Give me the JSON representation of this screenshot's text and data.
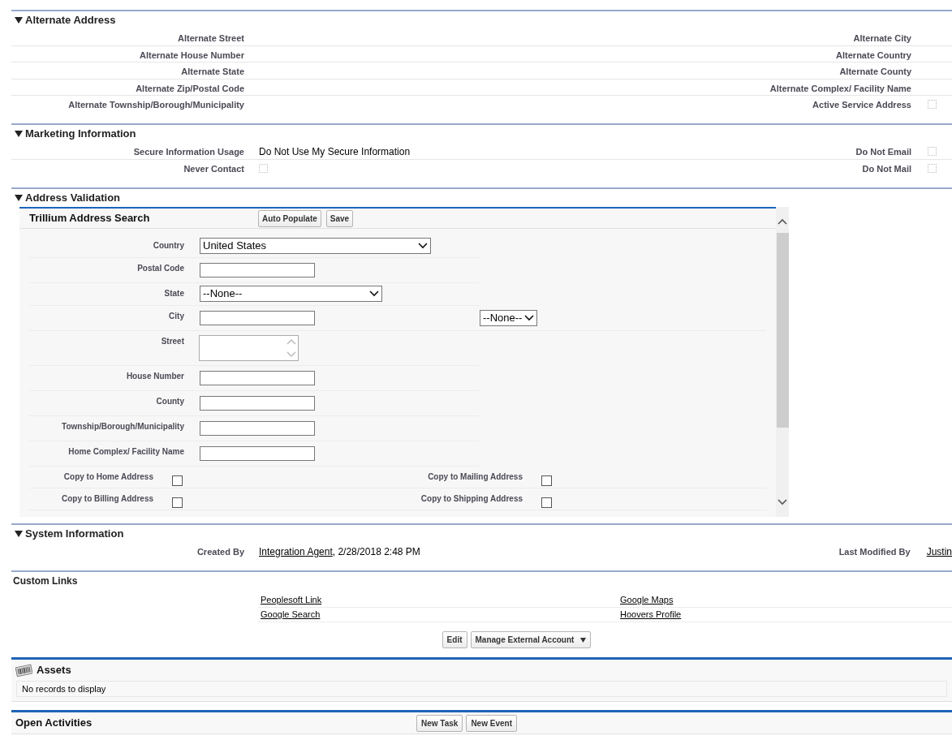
{
  "sections": [
    {
      "kind": "detail",
      "title": "Alternate Address",
      "expanded": true,
      "rows": [
        {
          "left": {
            "kind": "text",
            "label": "Alternate Street"
          },
          "right": {
            "kind": "text",
            "label": "Alternate City"
          }
        },
        {
          "left": {
            "kind": "text",
            "label": "Alternate House Number"
          },
          "right": {
            "kind": "text",
            "label": "Alternate Country"
          }
        },
        {
          "left": {
            "kind": "text",
            "label": "Alternate State"
          },
          "right": {
            "kind": "text",
            "label": "Alternate County"
          }
        },
        {
          "left": {
            "kind": "text",
            "label": "Alternate Zip/Postal Code"
          },
          "right": {
            "kind": "text",
            "label": "Alternate Complex/ Facility Name"
          }
        },
        {
          "left": {
            "kind": "text",
            "label": "Alternate Township/Borough/Municipality"
          },
          "right": {
            "kind": "checkbox",
            "label": "Active Service Address",
            "checked": false
          }
        }
      ]
    },
    {
      "kind": "detail",
      "title": "Marketing Information",
      "expanded": true,
      "rows": [
        {
          "left": {
            "kind": "text",
            "label": "Secure Information Usage",
            "value": "Do Not Use My Secure Information"
          },
          "right": {
            "kind": "checkbox",
            "label": "Do Not Email",
            "checked": false
          }
        },
        {
          "left": {
            "kind": "checkbox",
            "label": "Never Contact",
            "checked": false
          },
          "right": {
            "kind": "checkbox",
            "label": "Do Not Mail",
            "checked": false
          }
        }
      ]
    },
    {
      "kind": "embedded",
      "title": "Address Validation",
      "expanded": true,
      "panel": {
        "title": "Trillium Address Search",
        "buttons": [
          "Auto Populate",
          "Save"
        ],
        "fields": [
          {
            "kind": "select",
            "label": "Country",
            "value": "United States"
          },
          {
            "kind": "input",
            "label": "Postal Code"
          },
          {
            "kind": "select",
            "label": "State",
            "value": "--None--"
          },
          {
            "kind": "input",
            "label": "City",
            "extra_select": "--None--"
          },
          {
            "kind": "textarea",
            "label": "Street"
          },
          {
            "kind": "input",
            "label": "House Number"
          },
          {
            "kind": "input",
            "label": "County"
          },
          {
            "kind": "input",
            "label": "Township/Borough/Municipality"
          },
          {
            "kind": "input",
            "label": "Home Complex/ Facility Name"
          },
          {
            "kind": "checks",
            "items": [
              {
                "label": "Copy to Home Address",
                "checked": false
              },
              {
                "label": "Copy to Mailing Address",
                "checked": false
              }
            ]
          },
          {
            "kind": "checks",
            "items": [
              {
                "label": "Copy to Billing Address",
                "checked": false
              },
              {
                "label": "Copy to Shipping Address",
                "checked": false
              }
            ]
          }
        ]
      }
    },
    {
      "kind": "detail",
      "title": "System Information",
      "expanded": true,
      "rows": [
        {
          "left": {
            "kind": "link",
            "label": "Created By",
            "link": "Integration Agent",
            "value": ", 2/28/2018 2:48 PM"
          },
          "right": {
            "kind": "link",
            "label": "Last Modified By",
            "link": "Justin"
          }
        }
      ]
    }
  ],
  "custom_links": {
    "title": "Custom Links",
    "rows": [
      {
        "left": "Peoplesoft Link",
        "right": "Google Maps"
      },
      {
        "left": "Google Search",
        "right": "Hoovers Profile"
      }
    ]
  },
  "buttons": [
    {
      "kind": "plain",
      "label": "Edit"
    },
    {
      "kind": "menu",
      "label": "Manage External Account"
    }
  ],
  "related_lists": [
    {
      "title": "Assets",
      "icon": true,
      "message": "No records to display"
    },
    {
      "title": "Open Activities",
      "icon": false,
      "buttons": [
        "New Task",
        "New Event"
      ]
    }
  ]
}
